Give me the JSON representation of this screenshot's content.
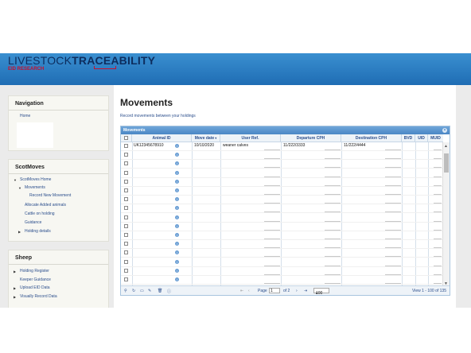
{
  "header": {
    "logo_thin": "LIVESTOCK",
    "logo_bold": "TRACEABILITY",
    "logo_sub": "EID RESEARCH"
  },
  "nav_panel": {
    "title": "Navigation",
    "items": [
      {
        "label": "Home"
      }
    ]
  },
  "scotmoves_panel": {
    "title": "ScotMoves",
    "items": [
      {
        "label": "ScotMoves Home"
      },
      {
        "label": "Movements"
      },
      {
        "label": "Record New Movement"
      },
      {
        "label": "Allocate Added animals"
      },
      {
        "label": "Cattle on holding"
      },
      {
        "label": "Guidance"
      },
      {
        "label": "Holding details"
      }
    ]
  },
  "sheep_panel": {
    "title": "Sheep",
    "items": [
      {
        "label": "Holding Register"
      },
      {
        "label": "Keeper Guidance"
      },
      {
        "label": "Upload EID Data"
      },
      {
        "label": "Visually Record Data"
      }
    ]
  },
  "main": {
    "title": "Movements",
    "subtitle": "Record movements between your holdings"
  },
  "grid": {
    "caption": "Movements",
    "columns": [
      "Animal ID",
      "Move date",
      "User Ref.",
      "Departure CPH",
      "Destination CPH",
      "BVD",
      "UID",
      "MUID"
    ],
    "rows": [
      {
        "animal_id": "UK12345678910",
        "move_date": "10/10/2020",
        "user_ref": "weaner calves",
        "departure": "11/222/3333",
        "destination": "11/222/4444"
      },
      {
        "animal_id": "",
        "move_date": "",
        "user_ref": "",
        "departure": "",
        "destination": ""
      },
      {
        "animal_id": "",
        "move_date": "",
        "user_ref": "",
        "departure": "",
        "destination": ""
      },
      {
        "animal_id": "",
        "move_date": "",
        "user_ref": "",
        "departure": "",
        "destination": ""
      },
      {
        "animal_id": "",
        "move_date": "",
        "user_ref": "",
        "departure": "",
        "destination": ""
      },
      {
        "animal_id": "",
        "move_date": "",
        "user_ref": "",
        "departure": "",
        "destination": ""
      },
      {
        "animal_id": "",
        "move_date": "",
        "user_ref": "",
        "departure": "",
        "destination": ""
      },
      {
        "animal_id": "",
        "move_date": "",
        "user_ref": "",
        "departure": "",
        "destination": ""
      },
      {
        "animal_id": "",
        "move_date": "",
        "user_ref": "",
        "departure": "",
        "destination": ""
      },
      {
        "animal_id": "",
        "move_date": "",
        "user_ref": "",
        "departure": "",
        "destination": ""
      },
      {
        "animal_id": "",
        "move_date": "",
        "user_ref": "",
        "departure": "",
        "destination": ""
      },
      {
        "animal_id": "",
        "move_date": "",
        "user_ref": "",
        "departure": "",
        "destination": ""
      },
      {
        "animal_id": "",
        "move_date": "",
        "user_ref": "",
        "departure": "",
        "destination": ""
      },
      {
        "animal_id": "",
        "move_date": "",
        "user_ref": "",
        "departure": "",
        "destination": ""
      },
      {
        "animal_id": "",
        "move_date": "",
        "user_ref": "",
        "departure": "",
        "destination": ""
      },
      {
        "animal_id": "",
        "move_date": "",
        "user_ref": "",
        "departure": "",
        "destination": ""
      }
    ],
    "pager": {
      "page_label": "Page",
      "page_value": "1",
      "of_label": "of 2",
      "per_page": "100",
      "range_text": "View 1 - 100 of 135"
    }
  }
}
